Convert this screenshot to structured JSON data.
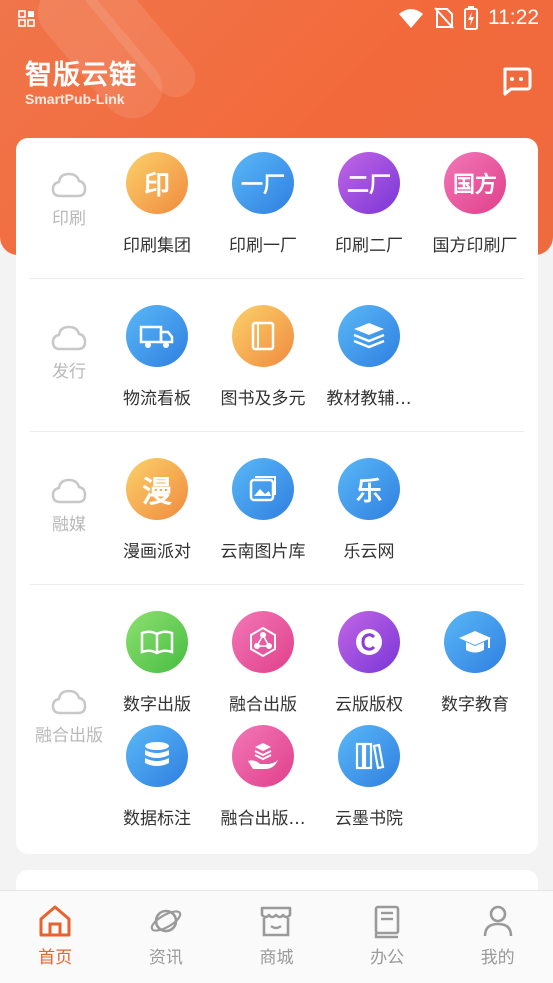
{
  "status": {
    "time": "11:22"
  },
  "header": {
    "title": "智版云链",
    "subtitle": "SmartPub-Link",
    "message_icon": "message-icon"
  },
  "sections": [
    {
      "category": "印刷",
      "apps": [
        {
          "label": "印刷集团",
          "icon_text": "印",
          "color": "orange"
        },
        {
          "label": "印刷一厂",
          "icon_text": "一厂",
          "color": "blue"
        },
        {
          "label": "印刷二厂",
          "icon_text": "二厂",
          "color": "purple"
        },
        {
          "label": "国方印刷厂",
          "icon_text": "国方",
          "color": "pink"
        }
      ]
    },
    {
      "category": "发行",
      "apps": [
        {
          "label": "物流看板",
          "icon": "truck-icon",
          "color": "blue"
        },
        {
          "label": "图书及多元",
          "icon": "book-icon",
          "color": "orange"
        },
        {
          "label": "教材教辅…",
          "icon": "stack-icon",
          "color": "blue"
        }
      ]
    },
    {
      "category": "融媒",
      "apps": [
        {
          "label": "漫画派对",
          "icon_text": "漫",
          "color": "orange"
        },
        {
          "label": "云南图片库",
          "icon": "image-icon",
          "color": "blue"
        },
        {
          "label": "乐云网",
          "icon_text": "乐",
          "color": "blue"
        }
      ]
    },
    {
      "category": "融合出版",
      "apps": [
        {
          "label": "数字出版",
          "icon": "open-book-icon",
          "color": "green"
        },
        {
          "label": "融合出版",
          "icon": "network-icon",
          "color": "pink"
        },
        {
          "label": "云版版权",
          "icon": "copyright-icon",
          "color": "purple"
        },
        {
          "label": "数字教育",
          "icon": "graduation-cap-icon",
          "color": "blue"
        },
        {
          "label": "数据标注",
          "icon": "database-icon",
          "color": "blue"
        },
        {
          "label": "融合出版…",
          "icon": "layers-hand-icon",
          "color": "pink"
        },
        {
          "label": "云墨书院",
          "icon": "books-icon",
          "color": "blue"
        }
      ]
    }
  ],
  "tabs": [
    {
      "label": "首页",
      "icon": "home-icon",
      "active": true
    },
    {
      "label": "资讯",
      "icon": "planet-icon",
      "active": false
    },
    {
      "label": "商城",
      "icon": "store-icon",
      "active": false
    },
    {
      "label": "办公",
      "icon": "notebook-icon",
      "active": false
    },
    {
      "label": "我的",
      "icon": "person-icon",
      "active": false
    }
  ],
  "colors": {
    "accent": "#e8622e",
    "header": "#f26a3c"
  }
}
